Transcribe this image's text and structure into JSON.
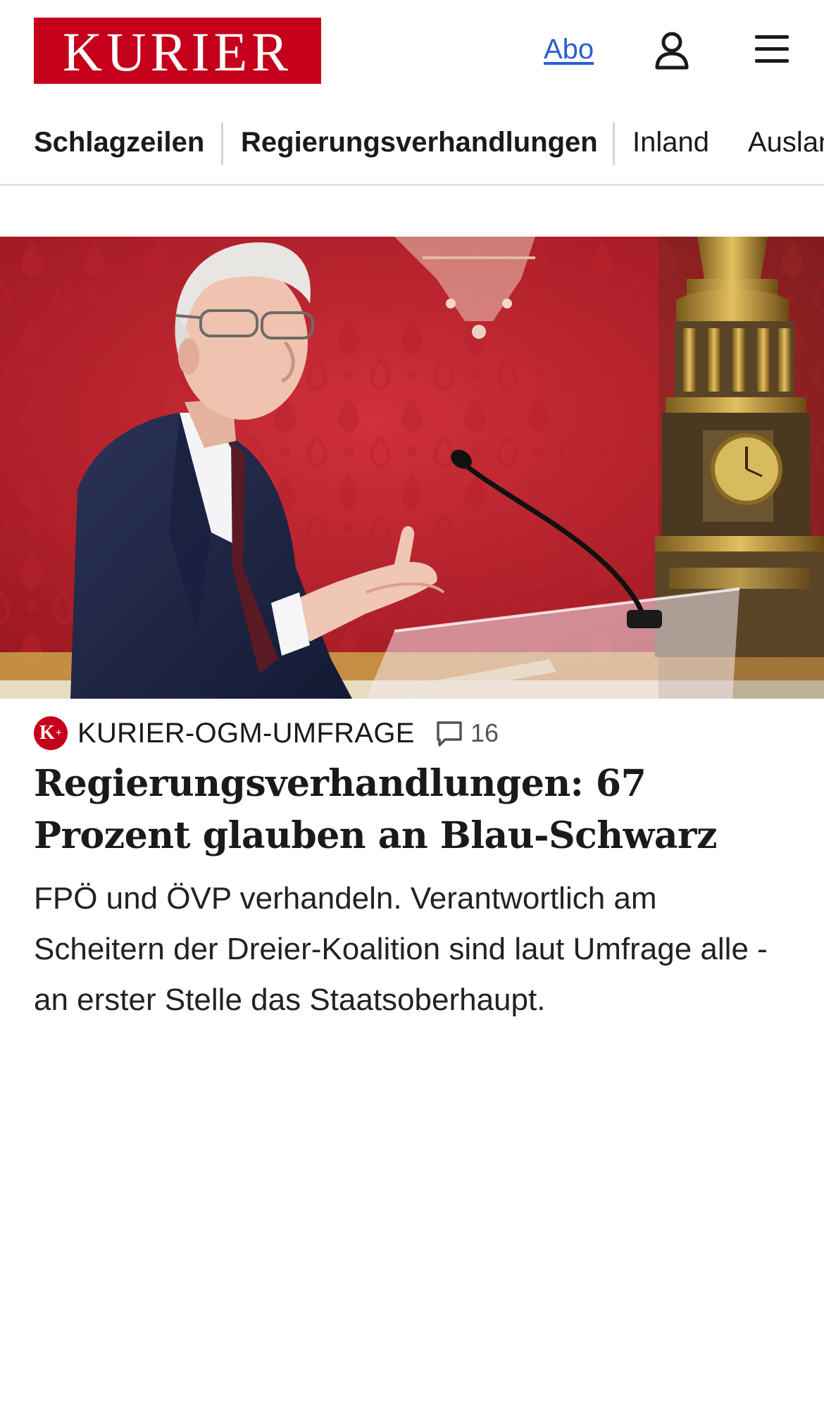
{
  "header": {
    "logo_text": "KURIER",
    "abo_label": "Abo",
    "user_icon": "user-icon",
    "menu_icon": "hamburger-menu-icon",
    "brand_color": "#c4001a",
    "link_color": "#2f5dd1"
  },
  "nav": {
    "items": [
      {
        "label": "Schlagzeilen"
      },
      {
        "label": "Regierungsverhandlungen"
      },
      {
        "label": "Inland"
      },
      {
        "label": "Ausland"
      }
    ]
  },
  "article": {
    "badge_text": "K",
    "badge_plus": "+",
    "kicker": "KURIER-OGM-UMFRAGE",
    "comment_icon": "comment-icon",
    "comment_count": "16",
    "headline": "Regierungsverhandlungen: 67 Prozent glauben an Blau-Schwarz",
    "teaser": "FPÖ und ÖVP verhandeln. Verantwortlich am Scheitern der Dreier-Koalition sind laut Umfrage alle - an erster Stelle das Staatsoberhaupt."
  }
}
